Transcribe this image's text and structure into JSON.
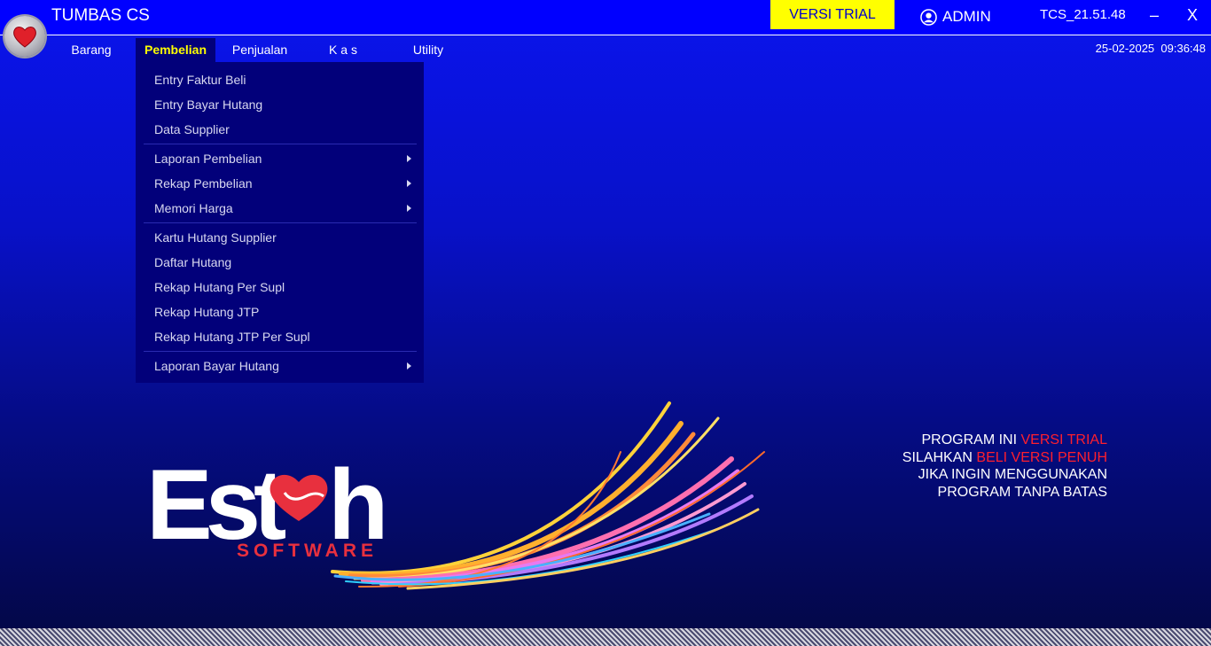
{
  "app": {
    "title": "TUMBAS CS",
    "trial_badge": "VERSI TRIAL",
    "user": "ADMIN",
    "version": "TCS_21.51.48",
    "minimize_label": "–",
    "close_label": "X",
    "date": "25-02-2025",
    "time": "09:36:48"
  },
  "menu": {
    "items": [
      {
        "label": "Barang"
      },
      {
        "label": "Pembelian",
        "active": true
      },
      {
        "label": "Penjualan"
      },
      {
        "label": "K a s"
      },
      {
        "label": "Utility"
      }
    ]
  },
  "dropdown": {
    "items": [
      {
        "label": "Entry Faktur Beli"
      },
      {
        "label": "Entry Bayar Hutang"
      },
      {
        "label": "Data Supplier"
      },
      {
        "label": "Laporan Pembelian",
        "submenu": true
      },
      {
        "label": "Rekap Pembelian",
        "submenu": true
      },
      {
        "label": "Memori Harga",
        "submenu": true
      },
      {
        "label": "Kartu Hutang Supplier"
      },
      {
        "label": "Daftar Hutang"
      },
      {
        "label": "Rekap Hutang Per Supl"
      },
      {
        "label": "Rekap Hutang JTP"
      },
      {
        "label": "Rekap Hutang JTP Per Supl"
      },
      {
        "label": "Laporan Bayar Hutang",
        "submenu": true
      }
    ]
  },
  "trial_message": {
    "line1_prefix": "PROGRAM INI ",
    "line1_highlight": "VERSI TRIAL",
    "line2_prefix": "SILAHKAN ",
    "line2_highlight": "BELI VERSI PENUH",
    "line3": "JIKA INGIN MENGGUNAKAN",
    "line4": "PROGRAM TANPA BATAS"
  },
  "brand": {
    "word_left": "Est",
    "word_right": "h",
    "subtitle": "SOFTWARE",
    "icon": "heart-icon"
  },
  "colors": {
    "title_bar": "#0000ff",
    "trial_badge_bg": "#ffff00",
    "menu_active_text": "#ffff00",
    "dropdown_bg": "#02007a",
    "highlight_red": "#ff1f2d",
    "brand_red": "#e8303e"
  }
}
